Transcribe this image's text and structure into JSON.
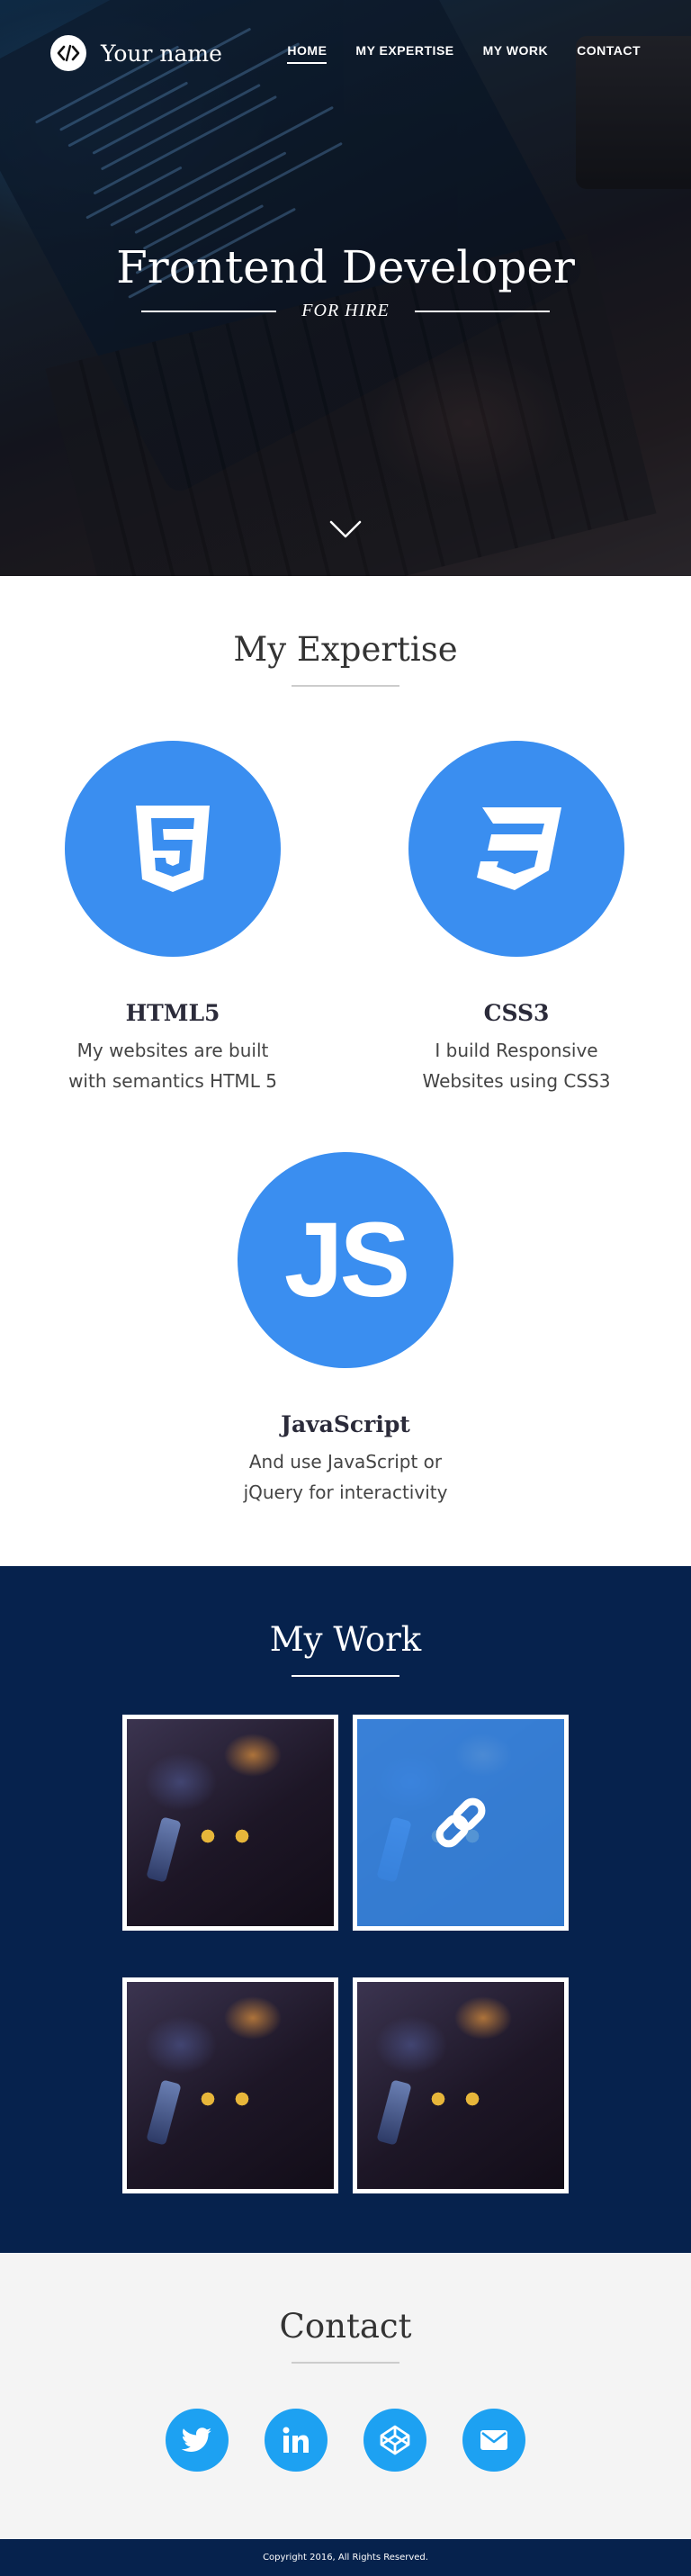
{
  "nav": {
    "brand": "Your name",
    "links": [
      {
        "label": "HOME",
        "active": true
      },
      {
        "label": "MY EXPERTISE",
        "active": false
      },
      {
        "label": "MY WORK",
        "active": false
      },
      {
        "label": "CONTACT",
        "active": false
      }
    ]
  },
  "hero": {
    "title": "Frontend Developer",
    "subtitle": "FOR HIRE",
    "scroll_icon": "chevron-down-icon"
  },
  "expertise": {
    "title": "My Expertise",
    "skills": [
      {
        "name": "HTML5",
        "desc_line1": "My websites are built",
        "desc_line2": "with semantics HTML 5",
        "icon": "html5-icon"
      },
      {
        "name": "CSS3",
        "desc_line1": "I build Responsive",
        "desc_line2": "Websites using CSS3",
        "icon": "css3-icon"
      },
      {
        "name": "JavaScript",
        "desc_line1": "And use JavaScript or",
        "desc_line2": "jQuery for interactivity",
        "icon": "js-icon",
        "icon_text": "JS"
      }
    ]
  },
  "work": {
    "title": "My Work",
    "hover_icon": "link-icon"
  },
  "contact": {
    "title": "Contact",
    "socials": [
      "twitter-icon",
      "linkedin-icon",
      "codepen-icon",
      "email-icon"
    ]
  },
  "footer": {
    "text": "Copyright 2016, All Rights Reserved."
  },
  "colors": {
    "accent": "#3a8ef0",
    "navy": "#06224d",
    "social": "#1da1f2"
  }
}
